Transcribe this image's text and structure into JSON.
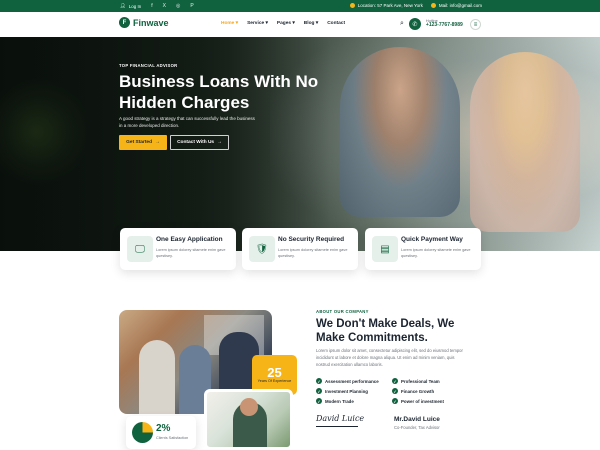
{
  "topbar": {
    "login": "Log In",
    "social": [
      "f",
      "X",
      "◎",
      "P"
    ],
    "location": "Location: 57 Park Ave, New York",
    "mail": "Mail: info@gmail.com"
  },
  "header": {
    "brand": "Finwave",
    "nav": [
      "Home",
      "Service",
      "Pages",
      "Blog",
      "Contact"
    ],
    "hotline_label": "Hotline",
    "hotline": "+123-7767-8989"
  },
  "hero": {
    "tagline": "TOP FINANCIAL ADVISOR",
    "title": "Business Loans With No Hidden Charges",
    "subtitle": "A good strategy is a strategy that can successfully lead the business in a more developed direction.",
    "primary_btn": "Get Started",
    "secondary_btn": "Contact With Us"
  },
  "features": [
    {
      "title": "One Easy Application",
      "desc": "Lorem ipsum dolorey sitamete enim gave questisey.",
      "icon": "monitor-icon"
    },
    {
      "title": "No Security Required",
      "desc": "Lorem ipsum dolorey sitamete enim gave questisey.",
      "icon": "shield-check-icon"
    },
    {
      "title": "Quick Payment Way",
      "desc": "Lorem ipsum dolorey sitamete enim gave questisey.",
      "icon": "payment-icon"
    }
  ],
  "about": {
    "eyebrow": "ABOUT OUR COMPANY",
    "title": "We Don't Make Deals, We Make Commitments.",
    "text": "Lorem ipsum dolor sit amet, consectetur adipiscing elit, sed do eiusmod tempor incididunt ut labore et dolore magna aliqua. Ut enim ad minim veniam, quis nostrud exercitation ullamco laboris.",
    "checks": [
      "Assessment performance",
      "Professional Team",
      "Investment Planning",
      "Finance Growth",
      "Modern Trade",
      "Power of investment"
    ],
    "signature": "David Luice",
    "person_name": "Mr.David Luice",
    "person_role": "Co-Founder, Tax Advisor",
    "years_value": "25",
    "years_label": "Years Of Experience",
    "stat_value": "2%",
    "stat_label": "Clients Satisfaction",
    "stat_fraction": 0.25
  },
  "colors": {
    "brand_green": "#10623f",
    "accent_yellow": "#f7b417"
  }
}
